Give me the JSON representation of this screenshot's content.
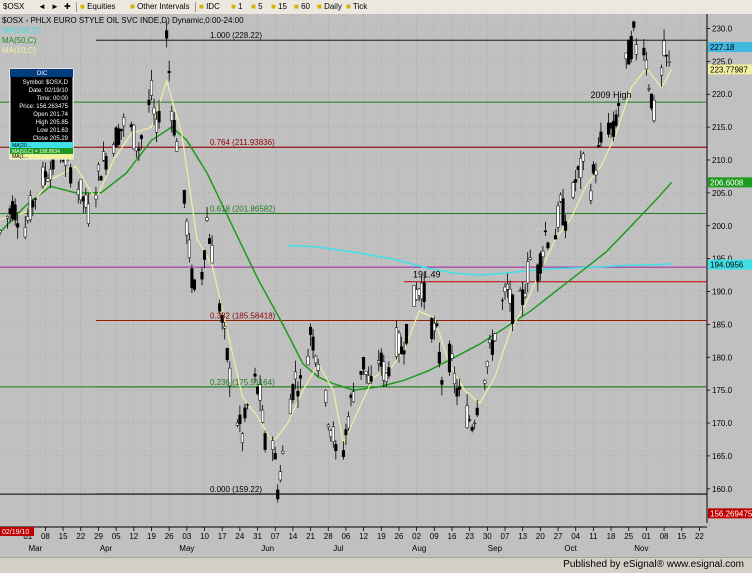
{
  "toolbar": {
    "symbol": "$OSX",
    "folder1": "Equities",
    "folder2": "Other Intervals",
    "idc": "IDC",
    "i1": "1",
    "i5": "5",
    "i15": "15",
    "i60": "60",
    "daily": "Daily",
    "tick": "Tick"
  },
  "chart_title": "$OSX - PHLX EURO STYLE OIL SVC INDE,D) Dynamic,0:00-24:00",
  "ma_legend": [
    "MA(200,C)",
    "MA(50,C)",
    "MA(10,C)"
  ],
  "data_window": {
    "header": "OIC",
    "rows": [
      "Symbol: $OSX,D",
      "Date: 02/19/10",
      "Time: 00:00",
      "Price: 156.263475",
      "Open 201.74",
      "High 205.85",
      "Low 201.63",
      "Close 205.29"
    ],
    "ma_rows": [
      "MA(20...",
      "MA(50,C) = 198.8634",
      "MA(1..."
    ]
  },
  "footer": {
    "published": "Published by eSignal®",
    "site": "www.esignal.com"
  },
  "colors": {
    "background": "#c0c0c0",
    "up_candle": "#ffffff",
    "down_candle": "#000000",
    "ma200": "#40e0e8",
    "ma50": "#1e9a1e",
    "ma10": "#f0f0a0",
    "fib": "#000000",
    "fib_label": "#8b0000"
  },
  "chart_data": {
    "type": "candlestick",
    "title": "$OSX - PHLX EURO STYLE OIL SVC INDE,D) Dynamic,0:00-24:00",
    "x_labels": [
      {
        "d": 1,
        "t": "01"
      },
      {
        "d": 8,
        "t": "08"
      },
      {
        "d": 15,
        "t": "15"
      },
      {
        "d": 22,
        "t": "22"
      },
      {
        "d": 29,
        "t": "29"
      },
      {
        "d": 36,
        "t": "05"
      },
      {
        "d": 43,
        "t": "12"
      },
      {
        "d": 50,
        "t": "19"
      },
      {
        "d": 57,
        "t": "26"
      },
      {
        "d": 64,
        "t": "03"
      },
      {
        "d": 71,
        "t": "10"
      },
      {
        "d": 78,
        "t": "17"
      },
      {
        "d": 85,
        "t": "24"
      },
      {
        "d": 92,
        "t": "31"
      },
      {
        "d": 99,
        "t": "07"
      },
      {
        "d": 106,
        "t": "14"
      },
      {
        "d": 113,
        "t": "21"
      },
      {
        "d": 120,
        "t": "28"
      },
      {
        "d": 127,
        "t": "06"
      },
      {
        "d": 134,
        "t": "12"
      },
      {
        "d": 141,
        "t": "19"
      },
      {
        "d": 148,
        "t": "26"
      },
      {
        "d": 155,
        "t": "02"
      },
      {
        "d": 162,
        "t": "09"
      },
      {
        "d": 169,
        "t": "16"
      },
      {
        "d": 176,
        "t": "23"
      },
      {
        "d": 183,
        "t": "30"
      },
      {
        "d": 190,
        "t": "07"
      },
      {
        "d": 197,
        "t": "13"
      },
      {
        "d": 204,
        "t": "20"
      },
      {
        "d": 211,
        "t": "27"
      },
      {
        "d": 218,
        "t": "04"
      },
      {
        "d": 225,
        "t": "11"
      },
      {
        "d": 232,
        "t": "18"
      },
      {
        "d": 239,
        "t": "25"
      },
      {
        "d": 246,
        "t": "01"
      },
      {
        "d": 253,
        "t": "08"
      },
      {
        "d": 260,
        "t": "15"
      },
      {
        "d": 267,
        "t": "22"
      }
    ],
    "month_labels": [
      {
        "d": 4,
        "t": "Mar"
      },
      {
        "d": 32,
        "t": "Apr"
      },
      {
        "d": 64,
        "t": "May"
      },
      {
        "d": 96,
        "t": "Jun"
      },
      {
        "d": 124,
        "t": "Jul"
      },
      {
        "d": 156,
        "t": "Aug"
      },
      {
        "d": 186,
        "t": "Sep"
      },
      {
        "d": 216,
        "t": "Oct"
      },
      {
        "d": 244,
        "t": "Nov"
      }
    ],
    "first_date_label": "02/19/10",
    "y_ticks": [
      160,
      165,
      170,
      175,
      180,
      185,
      190,
      195,
      200,
      205,
      210,
      215,
      220,
      225,
      230
    ],
    "ylim": [
      154.8,
      232.2
    ],
    "xlim": [
      -10,
      270
    ],
    "fib_levels": [
      {
        "label": "1.000 (228.22)",
        "value": 228.22,
        "x1": 28,
        "lc": "#000000"
      },
      {
        "label": "0.764 (211.93836)",
        "value": 211.93836,
        "x1": 28,
        "lc": "#8b0000"
      },
      {
        "label": "0.618 (201.86582)",
        "value": 201.86582,
        "x1": 28,
        "lc": "#1e7d1e"
      },
      {
        "label": "0.382 (185.58418)",
        "value": 185.58418,
        "x1": 28,
        "lc": "#8b2500"
      },
      {
        "label": "0.236 (175.51164)",
        "value": 175.51164,
        "x1": 28,
        "lc": "#1e7d1e"
      },
      {
        "label": "0.000 (159.22)",
        "value": 159.22,
        "x1": 28,
        "lc": "#000000"
      }
    ],
    "horizontal_lines": [
      {
        "value": 218.8,
        "color": "#1e7d1e",
        "x1": -10
      },
      {
        "value": 211.93,
        "color": "#8b0000",
        "x1": -10
      },
      {
        "value": 201.86,
        "color": "#1e7d1e",
        "x1": -10
      },
      {
        "value": 193.7,
        "color": "#a020a0",
        "x1": -10
      },
      {
        "value": 191.49,
        "color": "#c00000",
        "x1": 150
      },
      {
        "value": 185.6,
        "color": "#c00000",
        "x1": 28
      },
      {
        "value": 175.5,
        "color": "#1e7d1e",
        "x1": -10
      },
      {
        "value": 159.2,
        "color": "#000000",
        "x1": -10
      }
    ],
    "annotations": [
      {
        "text": "2009 High",
        "d": 232,
        "value": 218.8
      },
      {
        "text": "191.49",
        "d": 159,
        "value": 191.49
      }
    ],
    "right_labels": [
      {
        "text": "227.18",
        "value": 227.18,
        "bg": "#40b8e0"
      },
      {
        "text": "223.77987",
        "value": 223.78,
        "bg": "#f0f0a0"
      },
      {
        "text": "206.6008",
        "value": 206.6,
        "bg": "#1e9a1e"
      },
      {
        "text": "194.0956",
        "value": 194.1,
        "bg": "#40e0e8"
      },
      {
        "text": "156.269475",
        "value": 156.27,
        "bg": "#c00000"
      }
    ],
    "price_path": [
      [
        -10,
        199
      ],
      [
        -5,
        203
      ],
      [
        0,
        200
      ],
      [
        5,
        206
      ],
      [
        10,
        209
      ],
      [
        15,
        211
      ],
      [
        20,
        207
      ],
      [
        25,
        202
      ],
      [
        30,
        209
      ],
      [
        35,
        213
      ],
      [
        40,
        216
      ],
      [
        45,
        212
      ],
      [
        50,
        220
      ],
      [
        52,
        214
      ],
      [
        55,
        225
      ],
      [
        56,
        229
      ],
      [
        58,
        218
      ],
      [
        61,
        210
      ],
      [
        64,
        200
      ],
      [
        66,
        192
      ],
      [
        68,
        188
      ],
      [
        70,
        193
      ],
      [
        72,
        201
      ],
      [
        74,
        196
      ],
      [
        77,
        188
      ],
      [
        80,
        180
      ],
      [
        83,
        172
      ],
      [
        86,
        168
      ],
      [
        90,
        177
      ],
      [
        93,
        174
      ],
      [
        96,
        163
      ],
      [
        98,
        168
      ],
      [
        100,
        160
      ],
      [
        102,
        165
      ],
      [
        104,
        172
      ],
      [
        107,
        177
      ],
      [
        110,
        175
      ],
      [
        113,
        184
      ],
      [
        116,
        180
      ],
      [
        119,
        173
      ],
      [
        122,
        168
      ],
      [
        124,
        162
      ],
      [
        126,
        166
      ],
      [
        128,
        171
      ],
      [
        131,
        177
      ],
      [
        134,
        179
      ],
      [
        137,
        175
      ],
      [
        140,
        180
      ],
      [
        143,
        177
      ],
      [
        146,
        183
      ],
      [
        149,
        181
      ],
      [
        152,
        186
      ],
      [
        155,
        190
      ],
      [
        157,
        191
      ],
      [
        160,
        186
      ],
      [
        163,
        183
      ],
      [
        165,
        177
      ],
      [
        168,
        180
      ],
      [
        171,
        175
      ],
      [
        174,
        172
      ],
      [
        177,
        170
      ],
      [
        179,
        173
      ],
      [
        182,
        178
      ],
      [
        185,
        182
      ],
      [
        188,
        187
      ],
      [
        191,
        190
      ],
      [
        194,
        186
      ],
      [
        197,
        189
      ],
      [
        200,
        195
      ],
      [
        203,
        193
      ],
      [
        206,
        199
      ],
      [
        209,
        197
      ],
      [
        212,
        203
      ],
      [
        215,
        200
      ],
      [
        218,
        207
      ],
      [
        221,
        209
      ],
      [
        224,
        206
      ],
      [
        227,
        211
      ],
      [
        230,
        216
      ],
      [
        233,
        214
      ],
      [
        236,
        221
      ],
      [
        239,
        226
      ],
      [
        241,
        229
      ],
      [
        243,
        225
      ],
      [
        245,
        228
      ],
      [
        247,
        222
      ],
      [
        249,
        217
      ],
      [
        251,
        220
      ],
      [
        253,
        226
      ],
      [
        255,
        224
      ]
    ],
    "ma200": [
      [
        104,
        197
      ],
      [
        115,
        196.8
      ],
      [
        130,
        196
      ],
      [
        145,
        195
      ],
      [
        160,
        193.5
      ],
      [
        170,
        192.8
      ],
      [
        180,
        192.5
      ],
      [
        190,
        192.8
      ],
      [
        200,
        193.2
      ],
      [
        210,
        193.5
      ],
      [
        220,
        193.6
      ],
      [
        230,
        193.8
      ],
      [
        240,
        194
      ],
      [
        250,
        194.1
      ],
      [
        256,
        194.2
      ]
    ],
    "ma50": [
      [
        -10,
        199
      ],
      [
        0,
        203
      ],
      [
        10,
        206
      ],
      [
        20,
        205
      ],
      [
        30,
        205
      ],
      [
        40,
        208
      ],
      [
        50,
        213
      ],
      [
        58,
        215
      ],
      [
        64,
        213
      ],
      [
        72,
        208
      ],
      [
        82,
        200
      ],
      [
        92,
        192
      ],
      [
        102,
        185
      ],
      [
        110,
        179
      ],
      [
        116,
        177
      ],
      [
        122,
        176
      ],
      [
        130,
        175
      ],
      [
        140,
        175.5
      ],
      [
        150,
        176.5
      ],
      [
        160,
        178
      ],
      [
        170,
        180
      ],
      [
        180,
        182
      ],
      [
        190,
        184.5
      ],
      [
        200,
        187
      ],
      [
        210,
        190
      ],
      [
        220,
        193
      ],
      [
        230,
        196
      ],
      [
        240,
        200
      ],
      [
        250,
        204
      ],
      [
        256,
        206.6
      ]
    ],
    "ma10": [
      [
        -10,
        201
      ],
      [
        0,
        202
      ],
      [
        10,
        207
      ],
      [
        20,
        209
      ],
      [
        28,
        204
      ],
      [
        35,
        210
      ],
      [
        42,
        214
      ],
      [
        50,
        215
      ],
      [
        56,
        222
      ],
      [
        62,
        214
      ],
      [
        68,
        198
      ],
      [
        74,
        194
      ],
      [
        80,
        184
      ],
      [
        86,
        174
      ],
      [
        92,
        171
      ],
      [
        98,
        167
      ],
      [
        104,
        170
      ],
      [
        110,
        175
      ],
      [
        116,
        179
      ],
      [
        122,
        175
      ],
      [
        126,
        167
      ],
      [
        132,
        172
      ],
      [
        138,
        177
      ],
      [
        144,
        178
      ],
      [
        150,
        181
      ],
      [
        156,
        187
      ],
      [
        162,
        186
      ],
      [
        168,
        179
      ],
      [
        174,
        175
      ],
      [
        180,
        173
      ],
      [
        186,
        177
      ],
      [
        192,
        184
      ],
      [
        198,
        188
      ],
      [
        204,
        193
      ],
      [
        210,
        198
      ],
      [
        216,
        201
      ],
      [
        222,
        206
      ],
      [
        228,
        209
      ],
      [
        234,
        214
      ],
      [
        240,
        221
      ],
      [
        246,
        224
      ],
      [
        252,
        221
      ],
      [
        256,
        223.8
      ]
    ]
  }
}
